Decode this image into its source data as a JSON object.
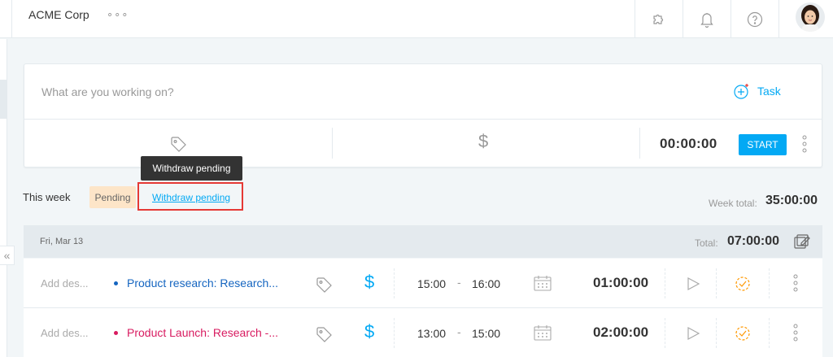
{
  "header": {
    "workspace": "ACME Corp",
    "workspace_menu": "∘∘∘",
    "icons": [
      "puzzle-icon",
      "bell-icon",
      "help-icon"
    ]
  },
  "tracker": {
    "placeholder": "What are you working on?",
    "task_label": "Task",
    "time": "00:00:00",
    "start_label": "START"
  },
  "tooltip": {
    "text": "Withdraw pending"
  },
  "week": {
    "label": "This week",
    "status_badge": "Pending",
    "withdraw_link": "Withdraw pending",
    "total_label": "Week total:",
    "total": "35:00:00"
  },
  "day": {
    "date": "Fri, Mar 13",
    "total_label": "Total:",
    "total": "07:00:00"
  },
  "entries": [
    {
      "description_placeholder": "Add des...",
      "project": "Product research: Research...",
      "project_color": "#1565c0",
      "start": "15:00",
      "dash": "-",
      "end": "16:00",
      "duration": "01:00:00"
    },
    {
      "description_placeholder": "Add des...",
      "project": "Product Launch: Research -...",
      "project_color": "#d81b60",
      "start": "13:00",
      "dash": "-",
      "end": "15:00",
      "duration": "02:00:00"
    }
  ],
  "colors": {
    "accent": "#03a9f4",
    "pending_bg": "#fde5c8",
    "highlight_border": "#e53935",
    "approval_icon": "#ff9800"
  }
}
